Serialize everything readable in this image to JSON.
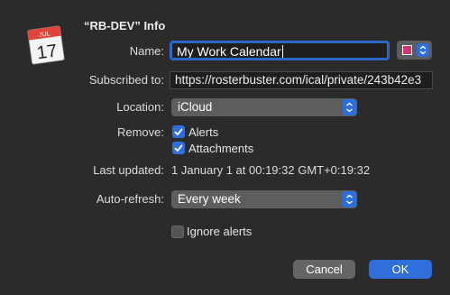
{
  "dialog": {
    "title": "“RB-DEV” Info"
  },
  "icon": {
    "month": "JUL",
    "day": "17",
    "name": "calendar-app-icon"
  },
  "fields": {
    "name_label": "Name:",
    "name_value": "My Work Calendar",
    "color": "#e0306e",
    "subscribed_label": "Subscribed to:",
    "subscribed_value": "https://rosterbuster.com/ical/private/243b42e3",
    "location_label": "Location:",
    "location_value": "iCloud",
    "remove_label": "Remove:",
    "remove_options": [
      {
        "label": "Alerts",
        "checked": true
      },
      {
        "label": "Attachments",
        "checked": true
      }
    ],
    "last_updated_label": "Last updated:",
    "last_updated_value": "1 January 1 at 00:19:32 GMT+0:19:32",
    "auto_refresh_label": "Auto-refresh:",
    "auto_refresh_value": "Every week",
    "ignore_alerts_label": "Ignore alerts",
    "ignore_alerts_checked": false
  },
  "buttons": {
    "cancel": "Cancel",
    "ok": "OK"
  },
  "colors": {
    "background": "#2b2b2b",
    "accent": "#2f6fdc",
    "focus_ring": "#2d67c6"
  }
}
